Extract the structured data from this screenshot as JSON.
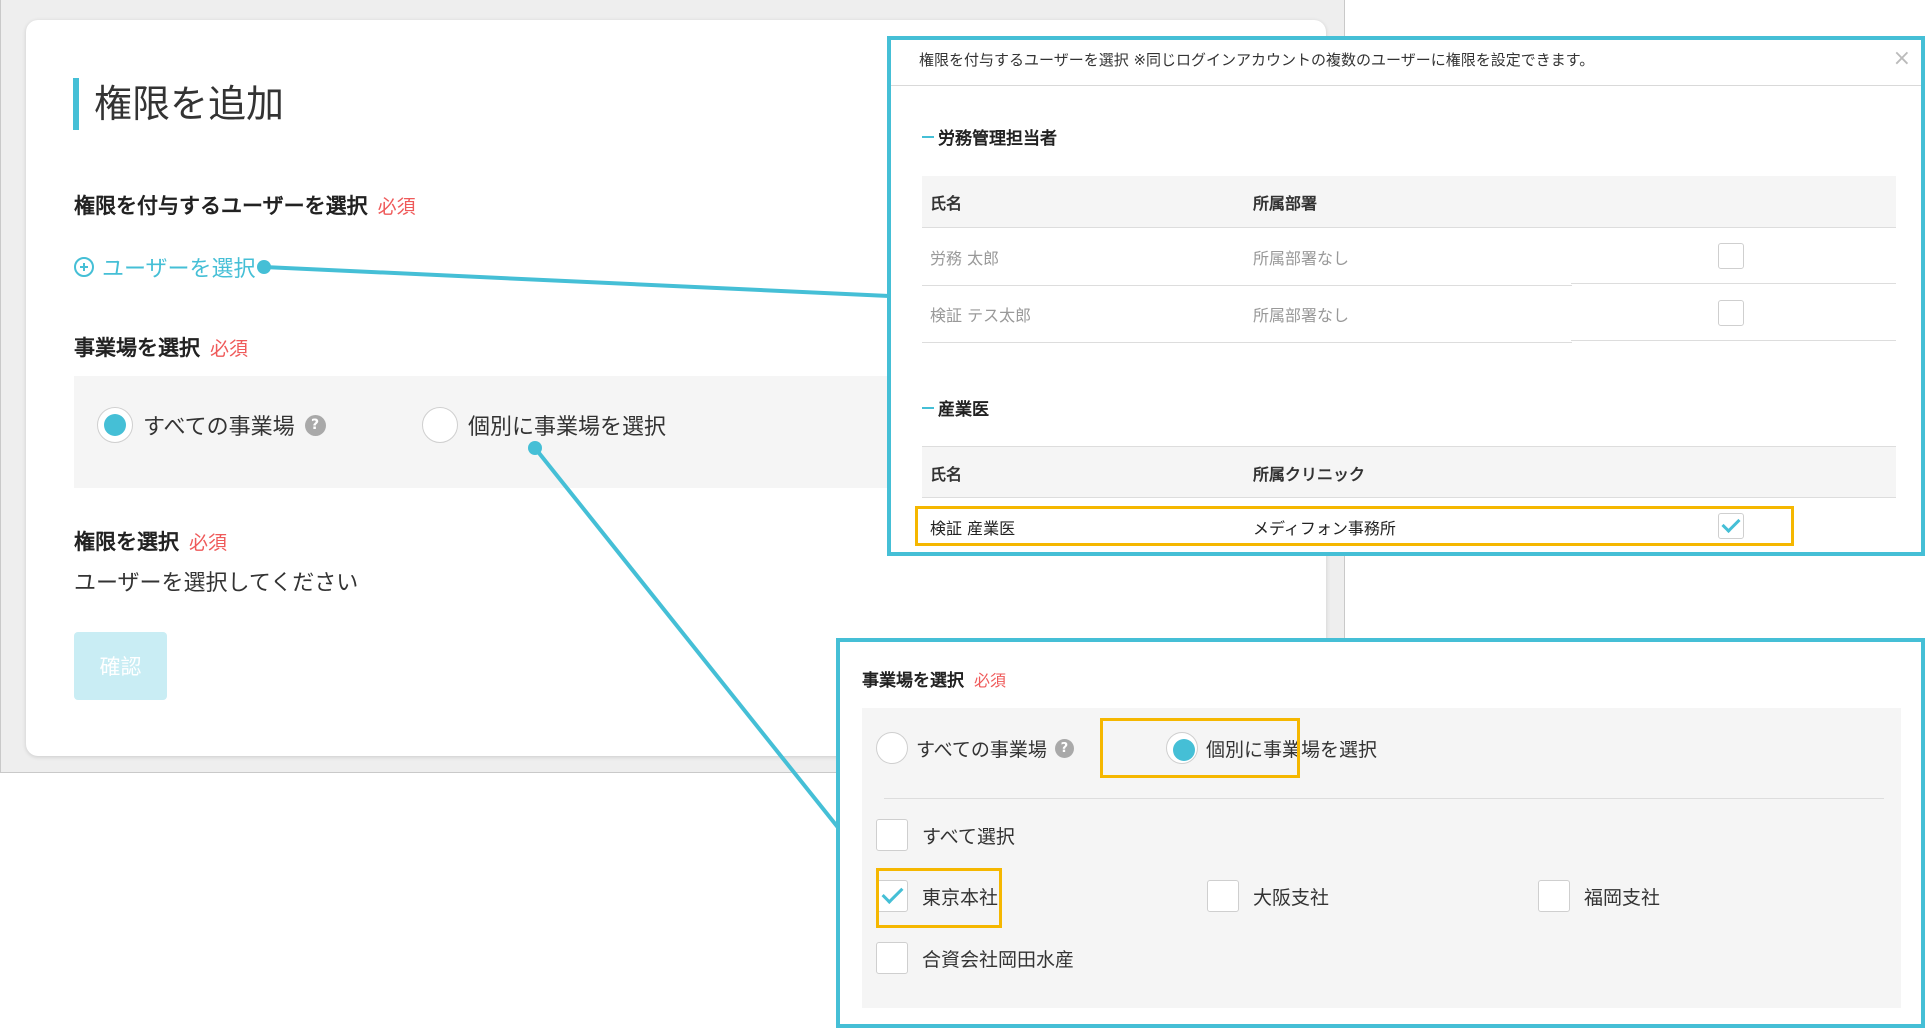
{
  "main": {
    "title": "権限を追加",
    "user_section": {
      "label": "権限を付与するユーザーを選択",
      "required": "必須"
    },
    "select_user_link": "ユーザーを選択",
    "facility_section": {
      "label": "事業場を選択",
      "required": "必須"
    },
    "radio_all": "すべての事業場",
    "radio_individual": "個別に事業場を選択",
    "help_glyph": "?",
    "permission_section": {
      "label": "権限を選択",
      "required": "必須"
    },
    "permission_hint": "ユーザーを選択してください",
    "confirm_button": "確認"
  },
  "user_modal": {
    "header": "権限を付与するユーザーを選択 ※同じログインアカウントの複数のユーザーに権限を設定できます。",
    "close_glyph": "×",
    "groups": [
      {
        "title": "労務管理担当者",
        "columns": [
          "氏名",
          "所属部署"
        ],
        "rows": [
          {
            "name": "労務 太郎",
            "dept": "所属部署なし",
            "checked": false
          },
          {
            "name": "検証 テス太郎",
            "dept": "所属部署なし",
            "checked": false
          }
        ]
      },
      {
        "title": "産業医",
        "columns": [
          "氏名",
          "所属クリニック"
        ],
        "rows": [
          {
            "name": "検証 産業医",
            "dept": "メディフォン事務所",
            "checked": true
          }
        ]
      }
    ]
  },
  "facility_callout": {
    "label": "事業場を選択",
    "required": "必須",
    "radio_all": "すべての事業場",
    "radio_individual": "個別に事業場を選択",
    "help_glyph": "?",
    "select_all": "すべて選択",
    "facilities": [
      {
        "name": "東京本社",
        "checked": true
      },
      {
        "name": "大阪支社",
        "checked": false
      },
      {
        "name": "福岡支社",
        "checked": false
      },
      {
        "name": "合資会社岡田水産",
        "checked": false
      }
    ]
  },
  "colors": {
    "accent": "#45bfd6",
    "required": "#ef5a5a",
    "highlight": "#f5b700"
  }
}
